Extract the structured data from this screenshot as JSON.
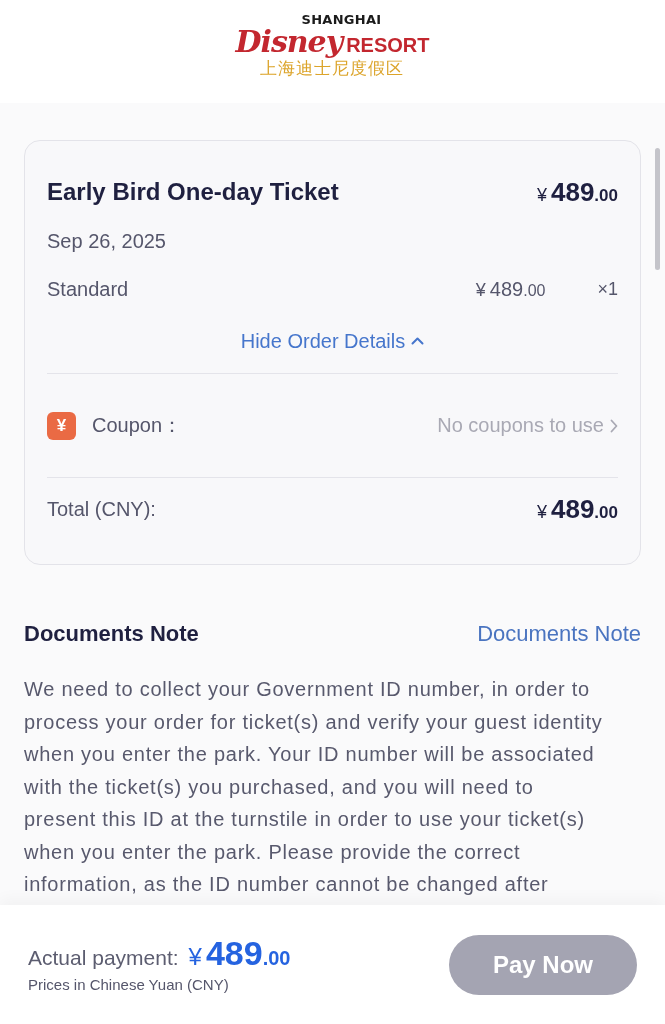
{
  "header": {
    "logo": {
      "top_line": "SHANGHAI",
      "wordmark": "Disney",
      "resort": "RESORT",
      "chinese": "上海迪士尼度假区"
    }
  },
  "order_card": {
    "title": "Early Bird One-day Ticket",
    "price": {
      "currency": "¥",
      "amount": "489",
      "decimals": ".00"
    },
    "date": "Sep 26, 2025",
    "items": [
      {
        "name": "Standard",
        "price": {
          "currency": "¥",
          "amount": "489",
          "decimals": ".00"
        },
        "quantity": "×1"
      }
    ],
    "details_toggle": {
      "label": "Hide Order Details",
      "expanded": true
    },
    "coupon": {
      "icon": "¥",
      "label": "Coupon：",
      "value": "No coupons to use"
    },
    "total": {
      "label": "Total (CNY):",
      "price": {
        "currency": "¥",
        "amount": "489",
        "decimals": ".00"
      }
    }
  },
  "documents_note": {
    "title": "Documents Note",
    "link": "Documents Note",
    "text": "We need to collect your Government ID number, in order to process your order for ticket(s) and verify your guest identity when you enter the park. Your ID number will be associated with the ticket(s) you purchased, and you will need to present this ID at the turnstile in order to use your ticket(s) when you enter the park. Please provide the correct information, as the ID number cannot be changed after"
  },
  "footer": {
    "label": "Actual payment:",
    "price": {
      "currency": "¥",
      "amount": "489",
      "decimals": ".00"
    },
    "note": "Prices in Chinese Yuan (CNY)",
    "pay_button": {
      "label": "Pay Now",
      "disabled": true
    }
  }
}
